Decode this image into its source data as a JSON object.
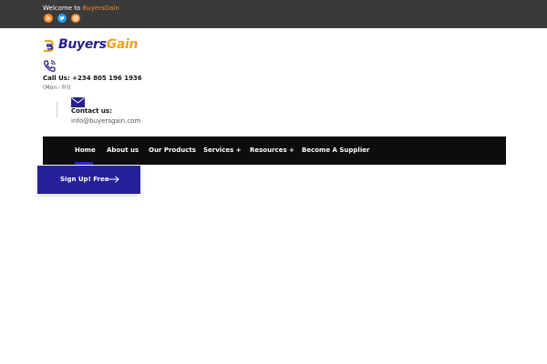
{
  "topbar": {
    "welcome_prefix": "Welcome to ",
    "welcome_brand": "BuyersGain",
    "social": [
      "rss-icon",
      "twitter-icon",
      "instagram-icon"
    ]
  },
  "logo": {
    "part1": "Buyers",
    "part2": "Gain"
  },
  "contact": {
    "call_label": "Call Us: +234 805 196 1936",
    "hours": "(Mon - Fri)",
    "contact_label": "Contact us:",
    "email": "info@buyersgain.com"
  },
  "nav": {
    "items": [
      "Home",
      "About us",
      "Our Products",
      "Services +",
      "Resources +",
      "Become A Supplier"
    ],
    "active": "Home"
  },
  "signup": {
    "label": "Sign Up! Free"
  },
  "colors": {
    "topbar": "#3a3a3a",
    "brand_orange": "#f08a24",
    "brand_blue": "#27209b",
    "nav_bg": "#0d0d0d",
    "active_underline": "#2b27c8"
  }
}
